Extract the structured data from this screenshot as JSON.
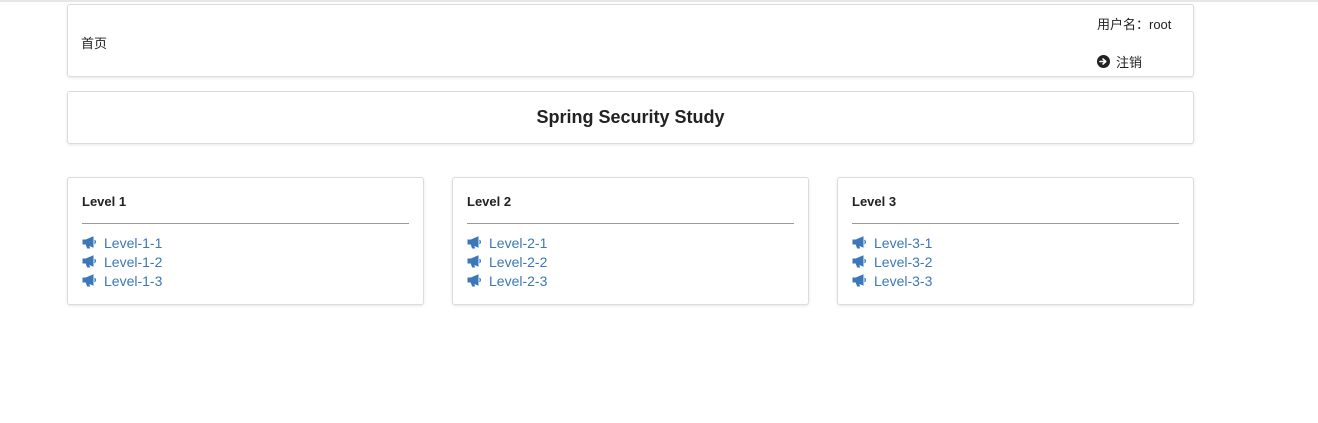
{
  "header": {
    "home_label": "首页",
    "username_label": "用户名：root",
    "logout_label": "注销"
  },
  "banner": {
    "title": "Spring Security Study"
  },
  "levels": [
    {
      "title": "Level 1",
      "links": [
        "Level-1-1",
        "Level-1-2",
        "Level-1-3"
      ]
    },
    {
      "title": "Level 2",
      "links": [
        "Level-2-1",
        "Level-2-2",
        "Level-2-3"
      ]
    },
    {
      "title": "Level 3",
      "links": [
        "Level-3-1",
        "Level-3-2",
        "Level-3-3"
      ]
    }
  ],
  "icons": {
    "logout": "arrow-circle-right-icon",
    "link": "bullhorn-icon"
  },
  "colors": {
    "link": "#3b77b9",
    "text": "#222222",
    "border": "#dcdcdc"
  }
}
